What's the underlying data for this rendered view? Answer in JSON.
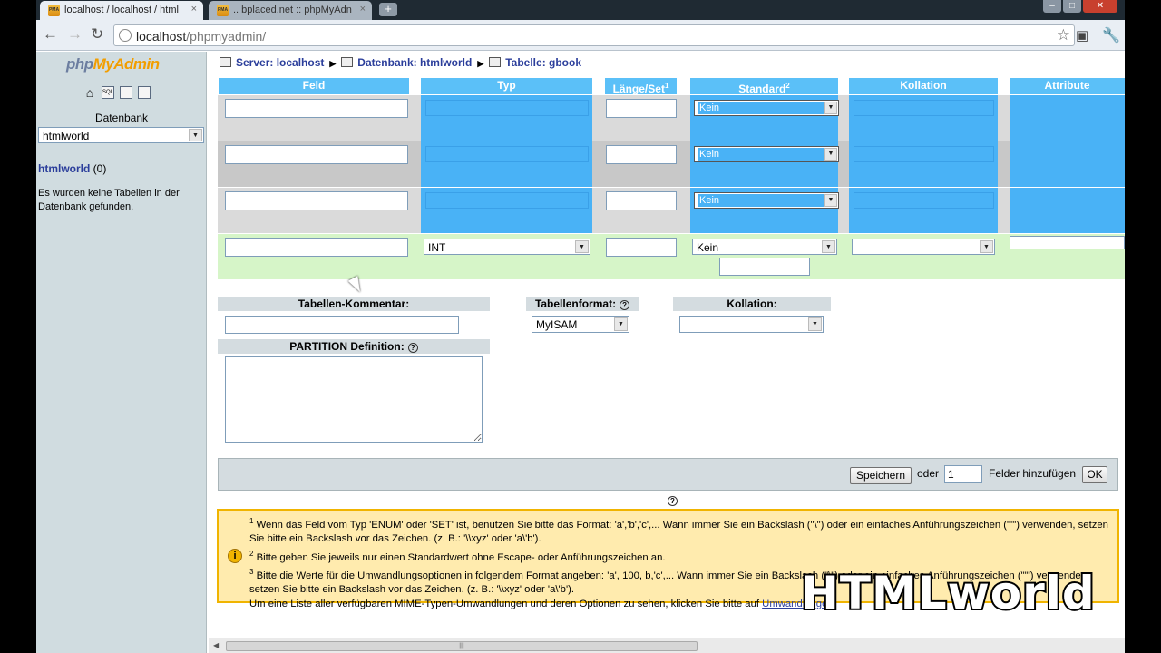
{
  "browser": {
    "tabs": [
      {
        "label": "localhost / localhost / html",
        "close": "×"
      },
      {
        "label": ".. bplaced.net :: phpMyAdn",
        "close": "×"
      }
    ],
    "new_tab": "+",
    "window_controls": {
      "minimize": "–",
      "maximize": "□",
      "close": "✕"
    },
    "nav": {
      "back": "←",
      "forward": "→",
      "reload": "↻"
    },
    "url_host": "localhost",
    "url_path": "/phpmyadmin/",
    "star": "☆",
    "wrench": "🔧"
  },
  "sidebar": {
    "logo_php": "php",
    "logo_my": "MyAdmin",
    "icons": [
      "home-icon",
      "sql-icon",
      "query-window-icon",
      "docs-icon"
    ],
    "sql_label": "SQL",
    "db_label": "Datenbank",
    "db_select": "htmlworld",
    "db_link": "htmlworld",
    "db_count": "(0)",
    "no_tables": "Es wurden keine Tabellen in der Datenbank gefunden."
  },
  "breadcrumb": {
    "server": "Server: localhost",
    "database": "Datenbank: htmlworld",
    "table": "Tabelle: gbook"
  },
  "columns": [
    {
      "label": "Feld"
    },
    {
      "label": "Typ"
    },
    {
      "label": "Länge/Set"
    },
    {
      "label": "Standard"
    },
    {
      "label": "Kollation"
    },
    {
      "label": "Attribute"
    }
  ],
  "header_footnotes": {
    "length": "1",
    "default": "2"
  },
  "field_rows": [
    {
      "type": "",
      "default": "Kein",
      "highlighted": true
    },
    {
      "type": "",
      "default": "Kein",
      "highlighted": true
    },
    {
      "type": "",
      "default": "Kein",
      "highlighted": true
    },
    {
      "type": "INT",
      "default": "Kein",
      "highlighted": false
    }
  ],
  "options": {
    "comment_label": "Tabellen-Kommentar:",
    "format_label": "Tabellenformat:",
    "format_value": "MyISAM",
    "collation_label": "Kollation:",
    "partition_label": "PARTITION Definition:",
    "help": "?"
  },
  "actions": {
    "save": "Speichern",
    "or": "oder",
    "add_count": "1",
    "add_fields": "Felder hinzufügen",
    "ok": "OK"
  },
  "notice": {
    "icon": "i",
    "n1": "1",
    "line1": "Wenn das Feld vom Typ 'ENUM' oder 'SET' ist, benutzen Sie bitte das Format: 'a','b','c',... Wann immer Sie ein Backslash (\"\\\") oder ein einfaches Anführungszeichen (\"'\") verwenden, setzen Sie bitte ein Backslash vor das Zeichen. (z. B.: '\\\\xyz' oder 'a\\'b').",
    "n2": "2",
    "line2": "Bitte geben Sie jeweils nur einen Standardwert ohne Escape- oder Anführungszeichen an.",
    "n3": "3",
    "line3": "Bitte die Werte für die Umwandlungsoptionen in folgendem Format angeben: 'a', 100, b,'c',... Wann immer Sie ein Backslash (\"\\\") oder ein einfaches Anführungszeichen (\"'\") verwenden, setzen Sie bitte ein Backslash vor das Zeichen. (z. B.: '\\\\xyz' oder 'a\\'b').",
    "line4": "Um eine Liste aller verfügbaren MIME-Typen-Umwandlungen und deren Optionen zu sehen, klicken Sie bitte auf",
    "link": "Umwandlungen"
  },
  "watermark": "HTMLworld",
  "colors": {
    "header_blue": "#5bc0f8",
    "highlight_blue": "#49b2f6",
    "gray_row": "#dadada",
    "green_row": "#d6f5c8",
    "notice_bg": "#ffebae",
    "notice_border": "#f0b400",
    "link_blue": "#2b3e9b"
  }
}
